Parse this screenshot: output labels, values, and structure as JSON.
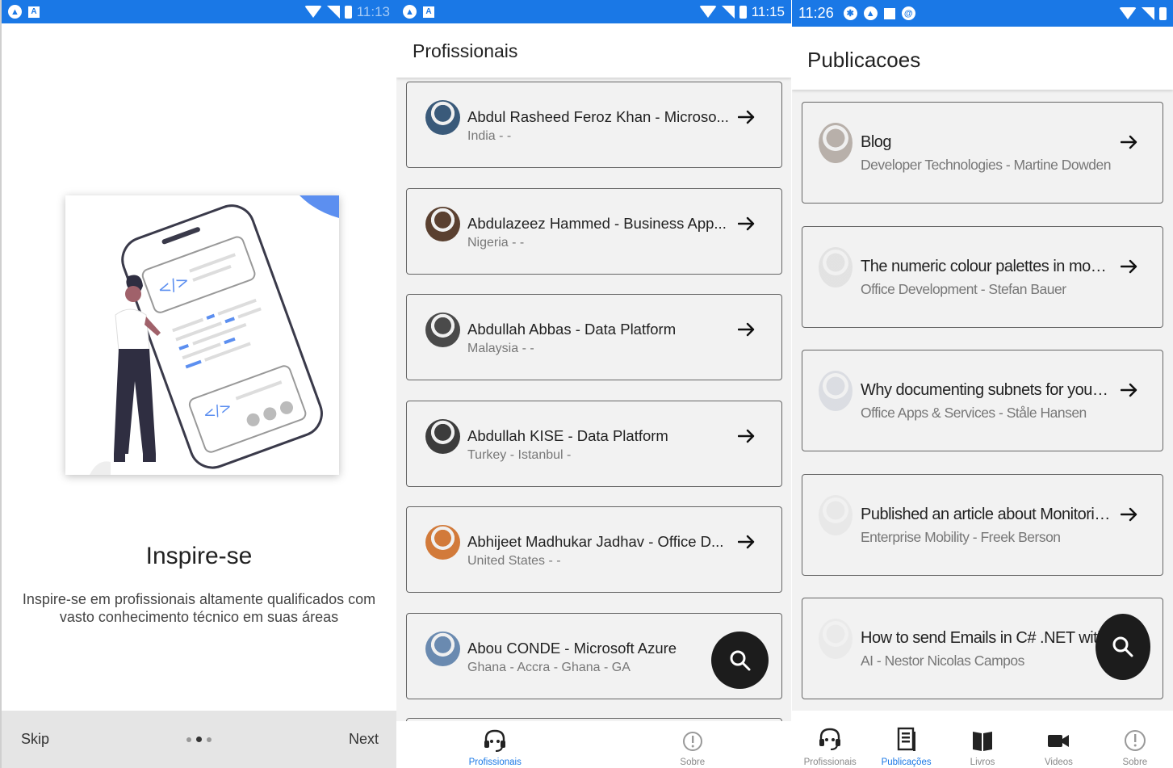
{
  "screen1": {
    "status": {
      "time": "11:13"
    },
    "title": "Inspire-se",
    "description": "Inspire-se em profissionais altamente qualificados com vasto conhecimento técnico em suas áreas",
    "skip_label": "Skip",
    "next_label": "Next",
    "pager": {
      "count": 3,
      "active_index": 1
    }
  },
  "screen2": {
    "status": {
      "time": "11:15"
    },
    "header_title": "Profissionais",
    "items": [
      {
        "title": "Abdul Rasheed Feroz Khan - Microso...",
        "subtitle": "India -  -"
      },
      {
        "title": "Abdulazeez Hammed - Business App...",
        "subtitle": "Nigeria -  -"
      },
      {
        "title": "Abdullah Abbas - Data Platform",
        "subtitle": "Malaysia -  -"
      },
      {
        "title": "Abdullah KISE - Data Platform",
        "subtitle": "Turkey - Istanbul -"
      },
      {
        "title": "Abhijeet Madhukar Jadhav - Office D...",
        "subtitle": "United States -  -"
      },
      {
        "title": "Abou CONDE - Microsoft Azure",
        "subtitle": "Ghana - Accra - Ghana -  GA"
      }
    ],
    "tabs": [
      {
        "label": "Profissionais",
        "icon": "headset-icon",
        "active": true
      },
      {
        "label": "Sobre",
        "icon": "info-icon",
        "active": false
      }
    ]
  },
  "screen3": {
    "status": {
      "time": "11:26"
    },
    "header_title": "Publicacoes",
    "items": [
      {
        "title": "Blog",
        "subtitle": "Developer Technologies - Martine Dowden"
      },
      {
        "title": "The numeric colour palettes in mode...",
        "subtitle": "Office Development - Stefan Bauer"
      },
      {
        "title": "Why documenting subnets for your T...",
        "subtitle": "Office Apps & Services - Ståle Hansen"
      },
      {
        "title": "Published an article about Monitorin...",
        "subtitle": "Enterprise Mobility - Freek Berson"
      },
      {
        "title": "How to send Emails in C# .NET with",
        "subtitle": "AI - Nestor Nicolas Campos"
      }
    ],
    "tabs": [
      {
        "label": "Profissionais",
        "icon": "headset-icon",
        "active": false
      },
      {
        "label": "Publicações",
        "icon": "document-icon",
        "active": true
      },
      {
        "label": "Livros",
        "icon": "book-icon",
        "active": false
      },
      {
        "label": "Videos",
        "icon": "video-icon",
        "active": false
      },
      {
        "label": "Sobre",
        "icon": "info-icon",
        "active": false
      }
    ]
  },
  "colors": {
    "accent": "#1a78e6",
    "fab": "#1c1c1c"
  }
}
